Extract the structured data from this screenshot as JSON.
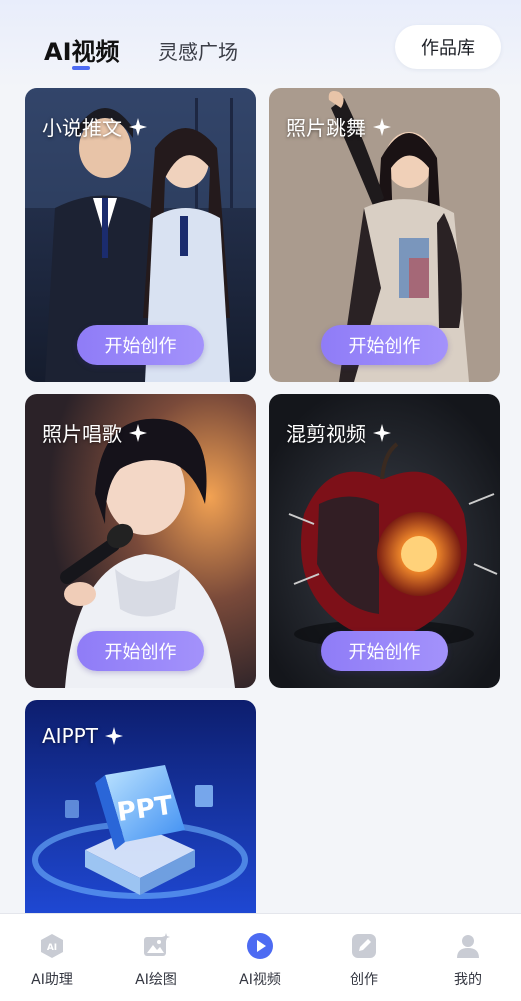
{
  "header": {
    "tabs": [
      {
        "label": "AI视频",
        "active": true
      },
      {
        "label": "灵感广场",
        "active": false
      }
    ],
    "works_button": "作品库"
  },
  "cards": [
    {
      "title": "小说推文",
      "button": "开始创作",
      "image": "couple-in-office-illustration"
    },
    {
      "title": "照片跳舞",
      "button": "开始创作",
      "image": "dancing-woman-photo"
    },
    {
      "title": "照片唱歌",
      "button": "开始创作",
      "image": "woman-singing-with-microphone"
    },
    {
      "title": "混剪视频",
      "button": "开始创作",
      "image": "mechanical-apple-render"
    },
    {
      "title": "AIPPT",
      "button": "",
      "image": "ppt-isometric-illustration"
    }
  ],
  "bottom_nav": [
    {
      "label": "AI助理",
      "icon": "ai-assistant-icon",
      "active": false
    },
    {
      "label": "AI绘图",
      "icon": "image-icon",
      "active": false
    },
    {
      "label": "AI视频",
      "icon": "play-icon",
      "active": true
    },
    {
      "label": "创作",
      "icon": "pencil-icon",
      "active": false
    },
    {
      "label": "我的",
      "icon": "user-icon",
      "active": false
    }
  ],
  "colors": {
    "accent": "#4d6bf2",
    "button_gradient_start": "#8f7cf7",
    "button_gradient_end": "#a392fb",
    "page_background": "#f3f5f9"
  }
}
